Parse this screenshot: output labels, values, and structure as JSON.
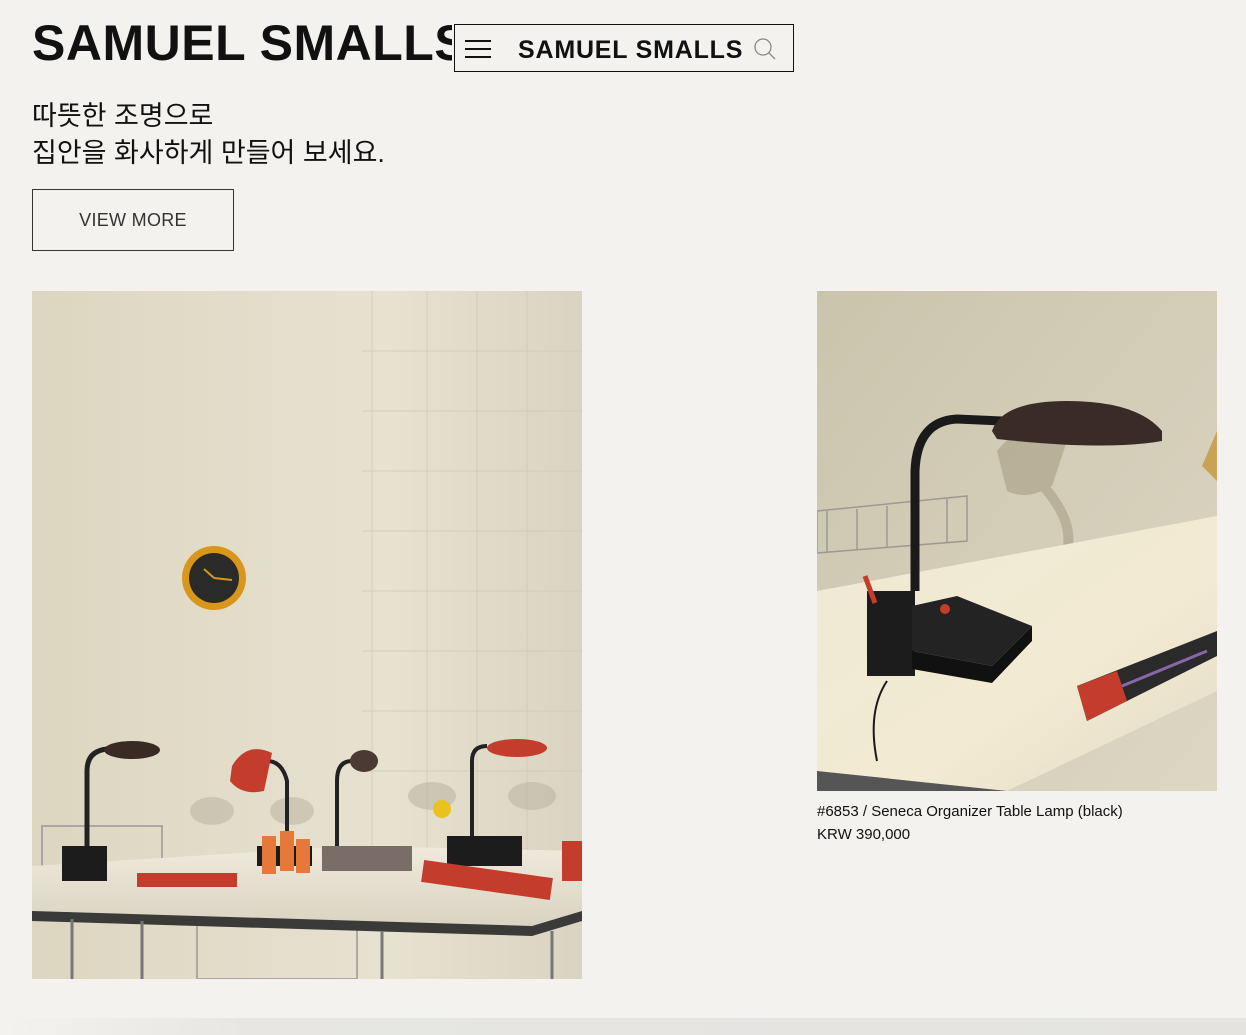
{
  "hero": {
    "title": "SAMUEL SMALLS LI",
    "tagline_line1": "따뜻한 조명으로",
    "tagline_line2": "집안을 화사하게 만들어 보세요.",
    "cta_label": "VIEW MORE"
  },
  "header": {
    "brand": "SAMUEL SMALLS",
    "menu_icon": "hamburger-menu-icon",
    "search_icon": "search-icon"
  },
  "gallery": {
    "main_image": "desk-lamps-collection-photo",
    "product_image": "seneca-organizer-lamp-photo"
  },
  "product": {
    "name": "#6853 / Seneca Organizer Table Lamp (black)",
    "price": "KRW 390,000"
  },
  "colors": {
    "background": "#f4f2ee",
    "text": "#111111",
    "accent_red": "#c0392b"
  }
}
